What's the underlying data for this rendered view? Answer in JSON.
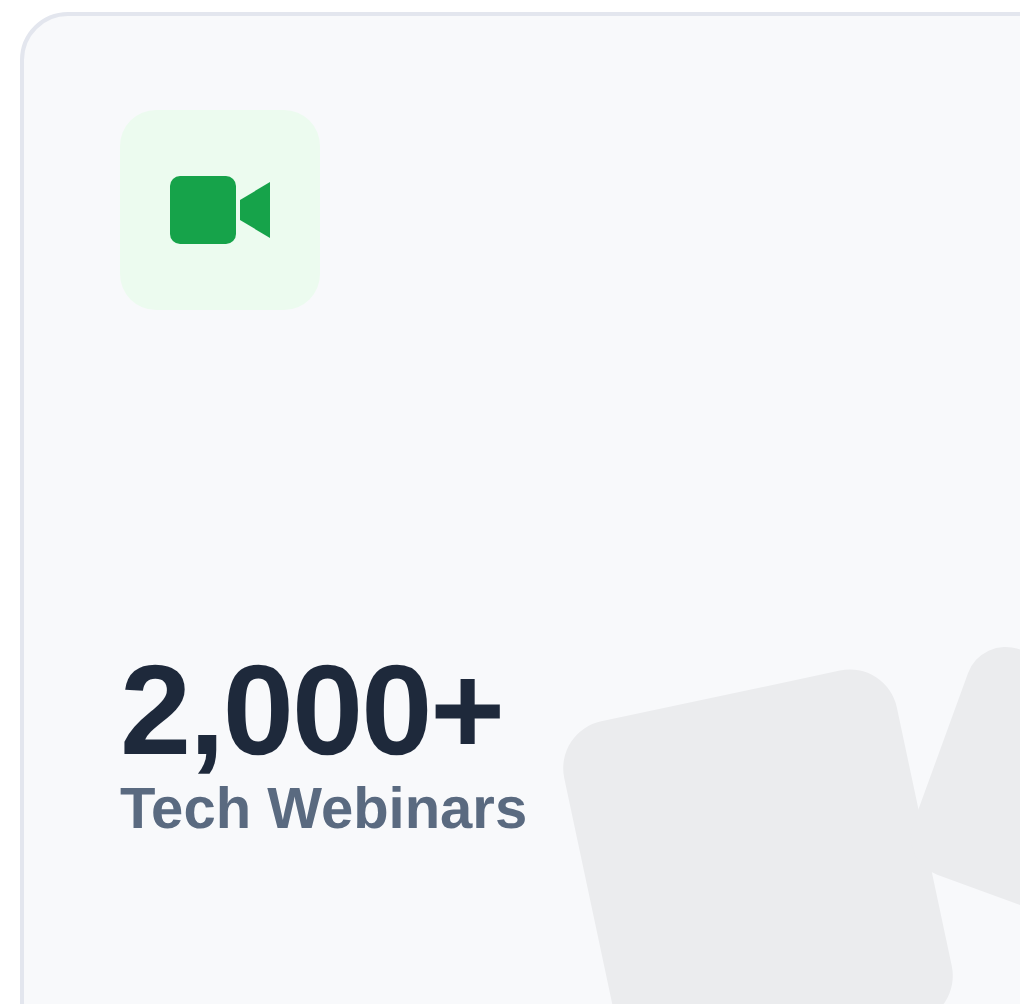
{
  "stat": {
    "value": "2,000+",
    "label": "Tech Webinars"
  }
}
